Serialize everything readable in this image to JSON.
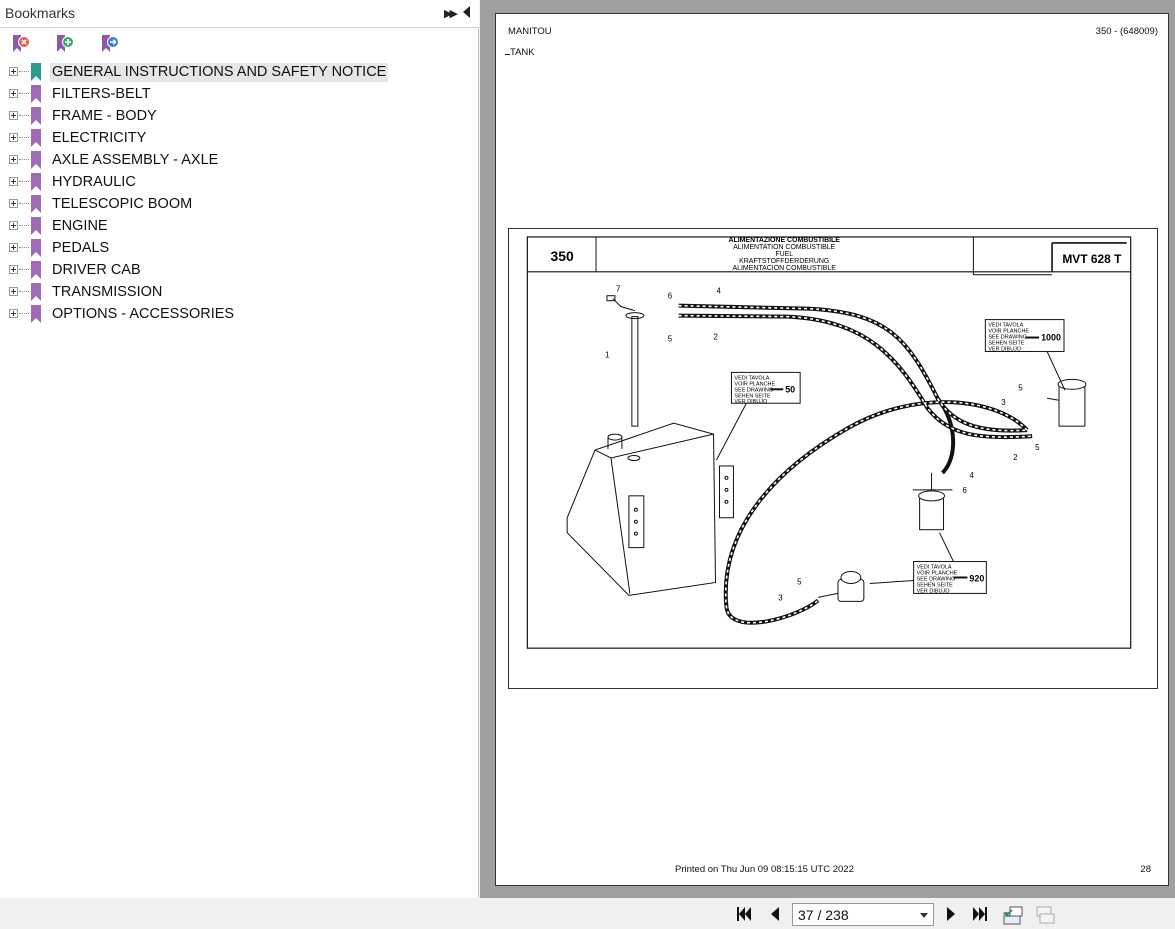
{
  "bookmarks_panel": {
    "title": "Bookmarks",
    "toolbar": {
      "remove_icon": "remove-bookmark-icon",
      "add_icon": "add-bookmark-icon",
      "goto_icon": "goto-bookmark-icon"
    },
    "items": [
      {
        "label": "GENERAL INSTRUCTIONS AND SAFETY NOTICE",
        "selected": true
      },
      {
        "label": "FILTERS-BELT"
      },
      {
        "label": "FRAME - BODY"
      },
      {
        "label": "ELECTRICITY"
      },
      {
        "label": "AXLE ASSEMBLY - AXLE"
      },
      {
        "label": "HYDRAULIC"
      },
      {
        "label": "TELESCOPIC BOOM"
      },
      {
        "label": "ENGINE"
      },
      {
        "label": "PEDALS"
      },
      {
        "label": "DRIVER CAB"
      },
      {
        "label": "TRANSMISSION"
      },
      {
        "label": "OPTIONS - ACCESSORIES"
      }
    ],
    "colors": {
      "selected_flag": "#2a9d8f",
      "flag": "#a06bb5"
    }
  },
  "document": {
    "brand": "MANITOU",
    "reference": "350 - (648009)",
    "section": "TANK",
    "printed": "Printed on  Thu Jun 09 08:15:15 UTC 2022",
    "page_number": "28",
    "drawing": {
      "plate_number": "350",
      "titles": [
        "ALIMENTAZIONE COMBUSTIBILE",
        "ALIMENTATION COMBUSTIBLE",
        "FUEL",
        "KRAFTSTOFFDERDERUNG",
        "ALIMENTACION COMBUSTIBLE"
      ],
      "model": "MVT 628 T",
      "refs": [
        {
          "lines": [
            "VEDI TAVOLA",
            "VOIR PLANCHE",
            "SEE DRAWING",
            "SEHEN SEITE",
            "VER DIBUJO"
          ],
          "target": "1000"
        },
        {
          "lines": [
            "VEDI TAVOLA",
            "VOIR PLANCHE",
            "SEE DRAWING",
            "SEHEN SEITE",
            "VER DIBUJO"
          ],
          "target": "50"
        },
        {
          "lines": [
            "VEDI TAVOLA",
            "VOIR PLANCHE",
            "SEE DRAWING",
            "SEHEN SEITE",
            "VER DIBUJO"
          ],
          "target": "920"
        }
      ],
      "callouts": [
        "7",
        "6",
        "4",
        "5",
        "2",
        "1",
        "5",
        "3",
        "5",
        "2",
        "4",
        "6",
        "5",
        "3"
      ]
    }
  },
  "navigation": {
    "page_indicator": "37 / 238",
    "first_icon": "first-page-icon",
    "prev_icon": "previous-page-icon",
    "next_icon": "next-page-icon",
    "last_icon": "last-page-icon",
    "fit_icon": "fit-page-icon",
    "continuous_icon": "continuous-page-icon"
  }
}
